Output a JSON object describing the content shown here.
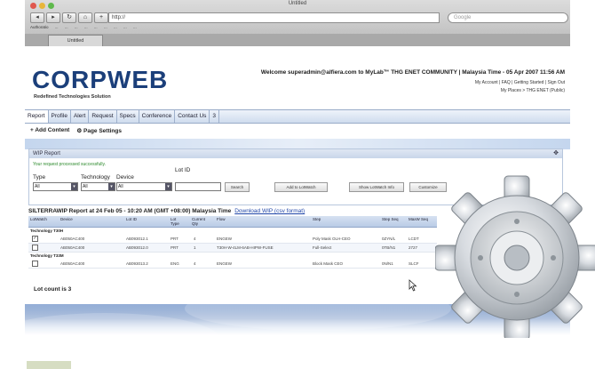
{
  "browser": {
    "window_title": "Untitled",
    "url": "http://",
    "search_placeholder": "Google",
    "bookmarks": [
      "Authoratio",
      "...",
      "...",
      "...",
      "...",
      "...",
      "...",
      "...",
      "...",
      "..."
    ],
    "tab": "Untitled"
  },
  "site": {
    "logo": "CORPWEB",
    "tagline": "Redefined Technologies Solution",
    "welcome": "Welcome superadmin@alfiera.com to MyLab™ THG ENET COMMUNITY | Malaysia Time - 05 Apr 2007 11:56 AM",
    "links_row1": "My Account | FAQ | Getting Started | Sign Out",
    "links_row2": "My Places > THG ENET (Public)",
    "menu": [
      "Report",
      "Profile",
      "Alert",
      "Request",
      "Specs",
      "Conference",
      "Contact Us",
      "3"
    ],
    "actions": [
      "+ Add Content",
      "⚙ Page Settings"
    ]
  },
  "panel": {
    "title": "WIP Report",
    "success_msg": "Your request processed successfully.",
    "filters": {
      "type_label": "Type",
      "type_value": "All",
      "tech_label": "Technology",
      "tech_value": "All",
      "device_label": "Device",
      "device_value": "All",
      "lotid_label": "Lot ID",
      "lotid_value": ""
    },
    "buttons": [
      "Search",
      "Add to LotWatch",
      "Show LotWatch Info",
      "Customize"
    ]
  },
  "report": {
    "title": "SILTERRAWIP Report at 24 Feb 05 - 10:20 AM (GMT +08:00) Malaysia Time",
    "download": "Download WIP (csv format)",
    "columns": [
      "LotWatch",
      "Device",
      "Lot ID",
      "Lot Type",
      "Current Qty",
      "Flow",
      "Step",
      "Step Seq",
      "MaxW Seq"
    ],
    "sections": [
      {
        "name": "Technology T30H",
        "rows": [
          {
            "checked": true,
            "device": "AB050AC400",
            "lot": "AB093012.1",
            "type": "PRT",
            "qty": "4",
            "flow": "ENGEW",
            "step": "Poly Mask OLH-CEO",
            "seq": "0ZYN/L",
            "maxw": "LCDT"
          },
          {
            "checked": false,
            "device": "AB050AC400",
            "lot": "AB093012.0",
            "type": "PRT",
            "qty": "1",
            "flow": "T30H-W-4LM-6AB-HIPW-FUSE",
            "step": "Full-Select",
            "seq": "0TB/N1",
            "maxw": "2727"
          }
        ]
      },
      {
        "name": "Technology T33M",
        "rows": [
          {
            "checked": false,
            "device": "AB050AC400",
            "lot": "AB093013.2",
            "type": "ENG",
            "qty": "4",
            "flow": "ENGEW",
            "step": "Block Mask CEO",
            "seq": "0N/N1",
            "maxw": "SLCF"
          }
        ]
      }
    ],
    "lot_count": "Lot count is 3"
  },
  "colors": {
    "logo": "#1b3f7a",
    "accent": "#4f8fd1",
    "success": "#2c8a2c",
    "link": "#2046a8"
  },
  "icons": [
    "gear-icon",
    "cursor-icon"
  ]
}
